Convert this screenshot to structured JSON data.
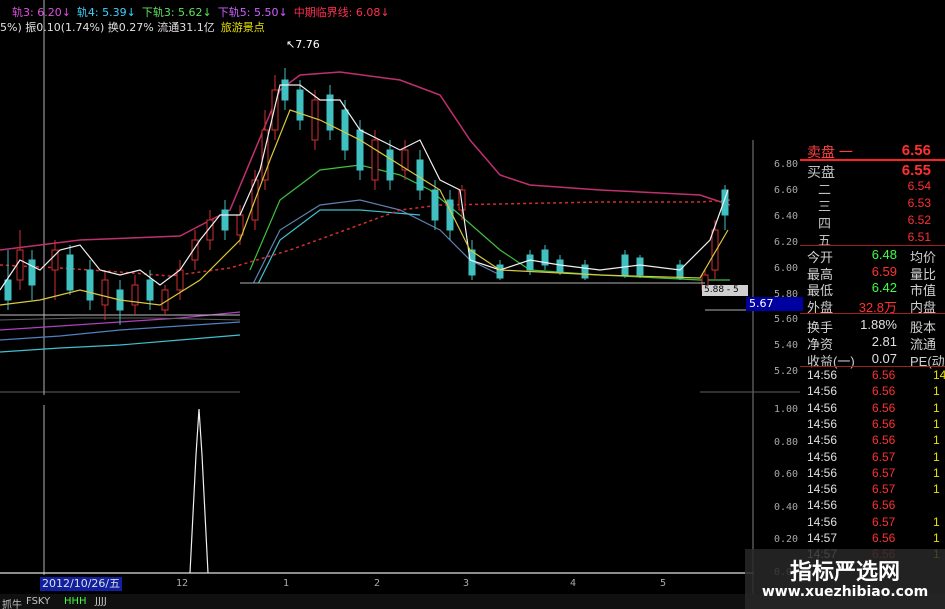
{
  "indicator_line_1": [
    {
      "text": "轨3: 6.20↓",
      "color": "#e050e0"
    },
    {
      "text": "轨4: 5.39↓",
      "color": "#40d0ff"
    },
    {
      "text": "下轨3: 5.62↓",
      "color": "#60e060"
    },
    {
      "text": "下轨5: 5.50↓",
      "color": "#d060ff"
    },
    {
      "text": "中期临界线: 6.08↓",
      "color": "#ff3050"
    }
  ],
  "indicator_line_2": [
    {
      "text": "5%) 振0.10(1.74%) 换0.27% 流通31.1亿",
      "color": "#e0e0e0"
    },
    {
      "text": "旅游景点",
      "color": "#e8e000"
    }
  ],
  "chart": {
    "high_marker": "7.76",
    "price_flags": [
      "5.88 - 5",
      "5.67"
    ],
    "y_ticks": [
      "6.80",
      "6.60",
      "6.40",
      "6.20",
      "6.00",
      "5.80",
      "5.60",
      "5.40",
      "5.20"
    ],
    "osc_ticks": [
      "1.00",
      "0.80",
      "0.60",
      "0.40",
      "0.20",
      "0.00"
    ],
    "date_cursor": "2012/10/26/五",
    "x_ticks": [
      "12",
      "1",
      "2",
      "3",
      "4",
      "5"
    ]
  },
  "order_book": {
    "sell": [
      {
        "label": "卖盘 一",
        "price": "6.56"
      },
      {
        "label": "二",
        "price": "6.54"
      },
      {
        "label": "三",
        "price": "6.53"
      },
      {
        "label": "四",
        "price": "6.52"
      },
      {
        "label": "五",
        "price": "6.51"
      }
    ],
    "buy_label": "买盘",
    "buy_price": "6.55"
  },
  "stats": [
    {
      "key": "今开",
      "value": "6.48",
      "key2": "均价",
      "color": "#40ff40"
    },
    {
      "key": "最高",
      "value": "6.59",
      "key2": "量比",
      "color": "#ff3030"
    },
    {
      "key": "最低",
      "value": "6.42",
      "key2": "市值",
      "color": "#40ff40"
    },
    {
      "key": "外盘",
      "value": "32.8万",
      "key2": "内盘",
      "color": "#ff3030"
    },
    {
      "key": "换手",
      "value": "1.88%",
      "key2": "股本",
      "color": "#e0e0e0"
    },
    {
      "key": "净资",
      "value": "2.81",
      "key2": "流通",
      "color": "#e0e0e0"
    },
    {
      "key": "收益(一)",
      "value": "0.07",
      "key2": "PE(动",
      "color": "#e0e0e0"
    }
  ],
  "ticks": [
    {
      "time": "14:56",
      "price": "6.56",
      "qty": "14"
    },
    {
      "time": "14:56",
      "price": "6.56",
      "qty": "1"
    },
    {
      "time": "14:56",
      "price": "6.56",
      "qty": "1"
    },
    {
      "time": "14:56",
      "price": "6.56",
      "qty": "1"
    },
    {
      "time": "14:56",
      "price": "6.56",
      "qty": "1"
    },
    {
      "time": "14:56",
      "price": "6.57",
      "qty": "1"
    },
    {
      "time": "14:56",
      "price": "6.57",
      "qty": "1"
    },
    {
      "time": "14:56",
      "price": "6.57",
      "qty": "1"
    },
    {
      "time": "14:56",
      "price": "6.56",
      "qty": ""
    },
    {
      "time": "14:56",
      "price": "6.57",
      "qty": "1"
    },
    {
      "time": "14:57",
      "price": "6.56",
      "qty": "1"
    },
    {
      "time": "14:57",
      "price": "6.56",
      "qty": "1"
    }
  ],
  "bottom_tabs": [
    "抓牛",
    "FSKY",
    "HHH",
    "JJJJ"
  ],
  "watermark": {
    "title": "指标严选网",
    "url": "www.xuezhibiao.com"
  }
}
